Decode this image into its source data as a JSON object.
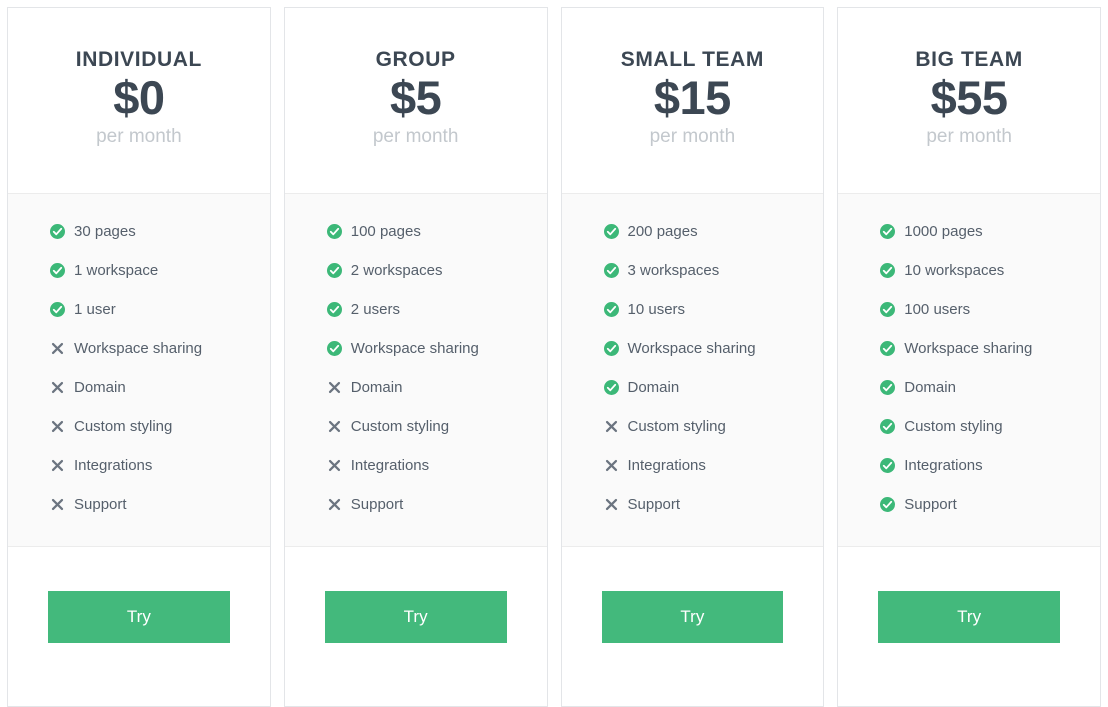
{
  "colors": {
    "accent_green": "#43b97c",
    "check_green": "#3cb878",
    "cross_gray": "#6b7480",
    "heading": "#3c4753",
    "period": "#c3c8cd",
    "feature_text": "#555f6b",
    "card_border": "#e3e5e8",
    "features_bg": "#fafafa"
  },
  "icons": {
    "included": "check-circle-icon",
    "excluded": "cross-icon"
  },
  "plans": [
    {
      "name": "INDIVIDUAL",
      "price": "$0",
      "period": "per month",
      "cta_label": "Try",
      "features": [
        {
          "label": "30 pages",
          "included": true
        },
        {
          "label": "1 workspace",
          "included": true
        },
        {
          "label": "1 user",
          "included": true
        },
        {
          "label": "Workspace sharing",
          "included": false
        },
        {
          "label": "Domain",
          "included": false
        },
        {
          "label": "Custom styling",
          "included": false
        },
        {
          "label": "Integrations",
          "included": false
        },
        {
          "label": "Support",
          "included": false
        }
      ]
    },
    {
      "name": "GROUP",
      "price": "$5",
      "period": "per month",
      "cta_label": "Try",
      "features": [
        {
          "label": "100 pages",
          "included": true
        },
        {
          "label": "2 workspaces",
          "included": true
        },
        {
          "label": "2 users",
          "included": true
        },
        {
          "label": "Workspace sharing",
          "included": true
        },
        {
          "label": "Domain",
          "included": false
        },
        {
          "label": "Custom styling",
          "included": false
        },
        {
          "label": "Integrations",
          "included": false
        },
        {
          "label": "Support",
          "included": false
        }
      ]
    },
    {
      "name": "SMALL TEAM",
      "price": "$15",
      "period": "per month",
      "cta_label": "Try",
      "features": [
        {
          "label": "200 pages",
          "included": true
        },
        {
          "label": "3 workspaces",
          "included": true
        },
        {
          "label": "10 users",
          "included": true
        },
        {
          "label": "Workspace sharing",
          "included": true
        },
        {
          "label": "Domain",
          "included": true
        },
        {
          "label": "Custom styling",
          "included": false
        },
        {
          "label": "Integrations",
          "included": false
        },
        {
          "label": "Support",
          "included": false
        }
      ]
    },
    {
      "name": "BIG TEAM",
      "price": "$55",
      "period": "per month",
      "cta_label": "Try",
      "features": [
        {
          "label": "1000 pages",
          "included": true
        },
        {
          "label": "10 workspaces",
          "included": true
        },
        {
          "label": "100 users",
          "included": true
        },
        {
          "label": "Workspace sharing",
          "included": true
        },
        {
          "label": "Domain",
          "included": true
        },
        {
          "label": "Custom styling",
          "included": true
        },
        {
          "label": "Integrations",
          "included": true
        },
        {
          "label": "Support",
          "included": true
        }
      ]
    }
  ]
}
